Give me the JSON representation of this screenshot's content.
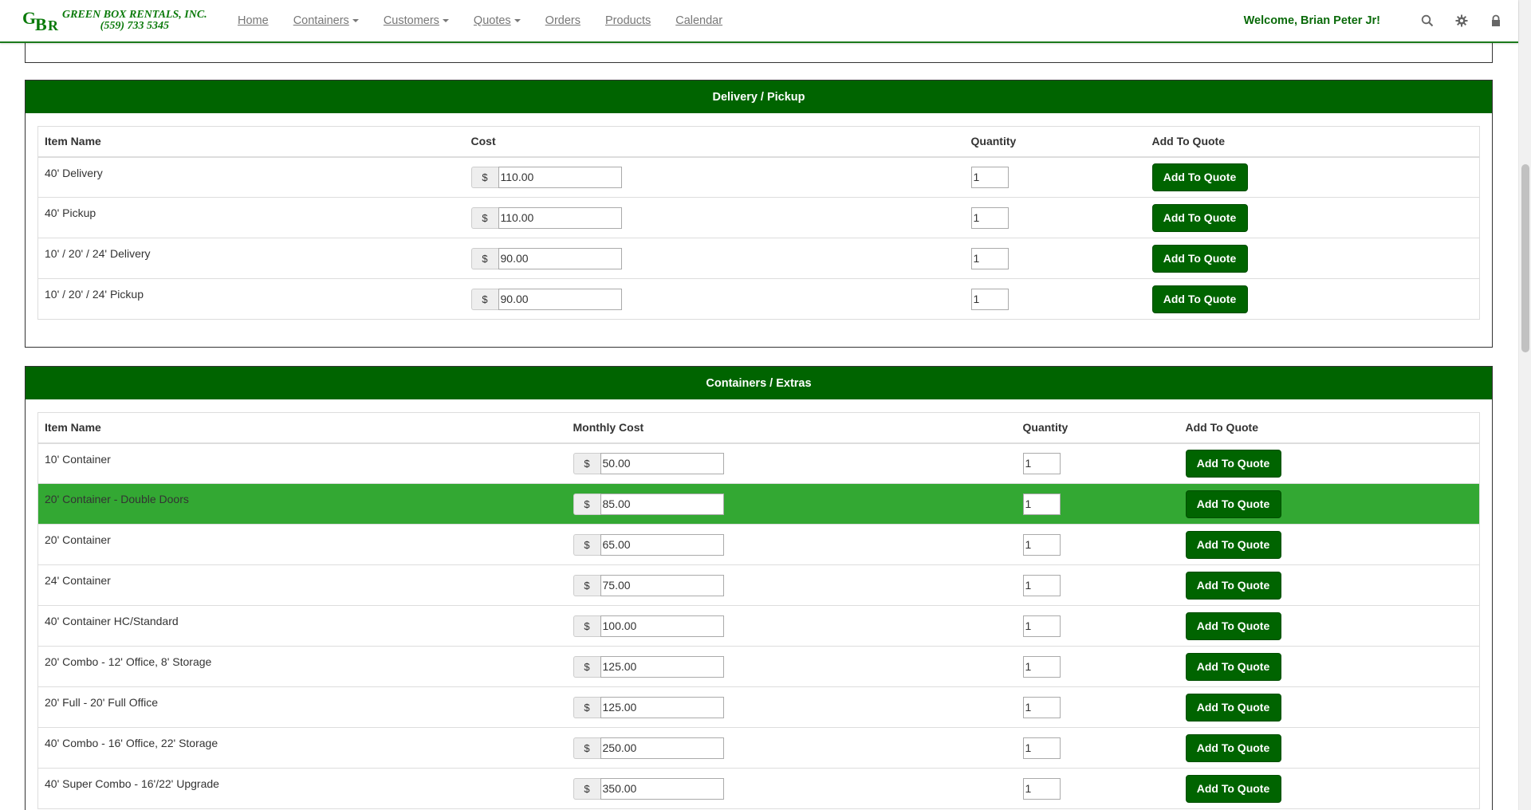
{
  "nav": {
    "brand_name": "GREEN BOX RENTALS, INC.",
    "brand_phone": "(559) 733 5345",
    "logo_letters": [
      "G",
      "B",
      "R"
    ],
    "links": [
      {
        "label": "Home",
        "dropdown": false
      },
      {
        "label": "Containers",
        "dropdown": true
      },
      {
        "label": "Customers",
        "dropdown": true
      },
      {
        "label": "Quotes",
        "dropdown": true
      },
      {
        "label": "Orders",
        "dropdown": false
      },
      {
        "label": "Products",
        "dropdown": false
      },
      {
        "label": "Calendar",
        "dropdown": false
      }
    ],
    "welcome": "Welcome, Brian Peter Jr!",
    "icons": [
      "search-icon",
      "gear-icon",
      "lock-icon"
    ]
  },
  "colors": {
    "brand_green": "#006400",
    "highlight_row": "#33a833",
    "welcome_text": "#0a6a0a"
  },
  "delivery_panel": {
    "title": "Delivery / Pickup",
    "headers": {
      "name": "Item Name",
      "cost": "Cost",
      "quantity": "Quantity",
      "add": "Add To Quote"
    },
    "currency": "$",
    "rows": [
      {
        "name": "40' Delivery",
        "cost": "110.00",
        "qty": "1",
        "button": "Add To Quote"
      },
      {
        "name": "40' Pickup",
        "cost": "110.00",
        "qty": "1",
        "button": "Add To Quote"
      },
      {
        "name": "10' / 20' / 24' Delivery",
        "cost": "90.00",
        "qty": "1",
        "button": "Add To Quote"
      },
      {
        "name": "10' / 20' / 24' Pickup",
        "cost": "90.00",
        "qty": "1",
        "button": "Add To Quote"
      }
    ]
  },
  "containers_panel": {
    "title": "Containers / Extras",
    "headers": {
      "name": "Item Name",
      "cost": "Monthly Cost",
      "quantity": "Quantity",
      "add": "Add To Quote"
    },
    "currency": "$",
    "highlighted_row": 1,
    "rows": [
      {
        "name": "10' Container",
        "cost": "50.00",
        "qty": "1",
        "button": "Add To Quote"
      },
      {
        "name": "20' Container - Double Doors",
        "cost": "85.00",
        "qty": "1",
        "button": "Add To Quote"
      },
      {
        "name": "20' Container",
        "cost": "65.00",
        "qty": "1",
        "button": "Add To Quote"
      },
      {
        "name": "24' Container",
        "cost": "75.00",
        "qty": "1",
        "button": "Add To Quote"
      },
      {
        "name": "40' Container HC/Standard",
        "cost": "100.00",
        "qty": "1",
        "button": "Add To Quote"
      },
      {
        "name": "20' Combo - 12' Office, 8' Storage",
        "cost": "125.00",
        "qty": "1",
        "button": "Add To Quote"
      },
      {
        "name": "20' Full - 20' Full Office",
        "cost": "125.00",
        "qty": "1",
        "button": "Add To Quote"
      },
      {
        "name": "40' Combo - 16' Office, 22' Storage",
        "cost": "250.00",
        "qty": "1",
        "button": "Add To Quote"
      },
      {
        "name": "40' Super Combo - 16'/22' Upgrade",
        "cost": "350.00",
        "qty": "1",
        "button": "Add To Quote"
      }
    ]
  }
}
